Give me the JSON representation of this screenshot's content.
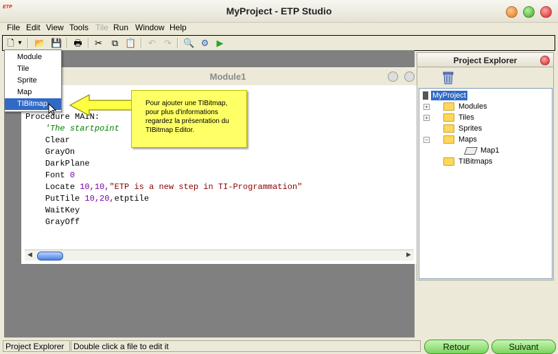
{
  "window": {
    "title": "MyProject - ETP Studio",
    "app_icon_text": "ETP"
  },
  "menu": [
    "File",
    "Edit",
    "View",
    "Tools",
    "Tile",
    "Run",
    "Window",
    "Help"
  ],
  "toolbar": {
    "new": "🗋",
    "dropdown": "▾",
    "open": "📂",
    "save": "💾",
    "print": "🖶",
    "cut": "✂",
    "copy": "⧉",
    "paste": "📋",
    "undo": "↶",
    "redo": "↷",
    "find": "🔍",
    "compile": "⚙",
    "run": "▶"
  },
  "new_menu": {
    "items": [
      "Module",
      "Tile",
      "Sprite",
      "Map",
      "TIBitmap"
    ],
    "selected": "TIBitmap"
  },
  "callout": {
    "text": "Pour ajouter une TIBitmap, pour plus d'informations regardez la présentation du TIBitmap Editor."
  },
  "document": {
    "title": "Module1",
    "code": {
      "proc_line": "Procedure MAIN:",
      "comment": "'The startpoint",
      "clear": "Clear",
      "grayon": "GrayOn",
      "darkplane": "DarkPlane",
      "font_kw": "Font ",
      "font_arg": "0",
      "locate_kw": "Locate ",
      "locate_num": "10,10,",
      "locate_str": "\"ETP is a new step in TI-Programmation\"",
      "puttile_kw": "PutTile ",
      "puttile_num": "10,20,",
      "puttile_arg": "etptile",
      "waitkey": "WaitKey",
      "grayoff": "GrayOff"
    }
  },
  "explorer": {
    "title": "Project Explorer",
    "root": "MyProject",
    "folders": [
      "Modules",
      "Tiles",
      "Sprites",
      "Maps",
      "TIBitmaps"
    ],
    "maps_children": [
      "Map1"
    ]
  },
  "status": {
    "panel": "Project Explorer",
    "hint": "Double click a file to edit it"
  },
  "nav": {
    "back": "Retour",
    "next": "Suivant"
  }
}
